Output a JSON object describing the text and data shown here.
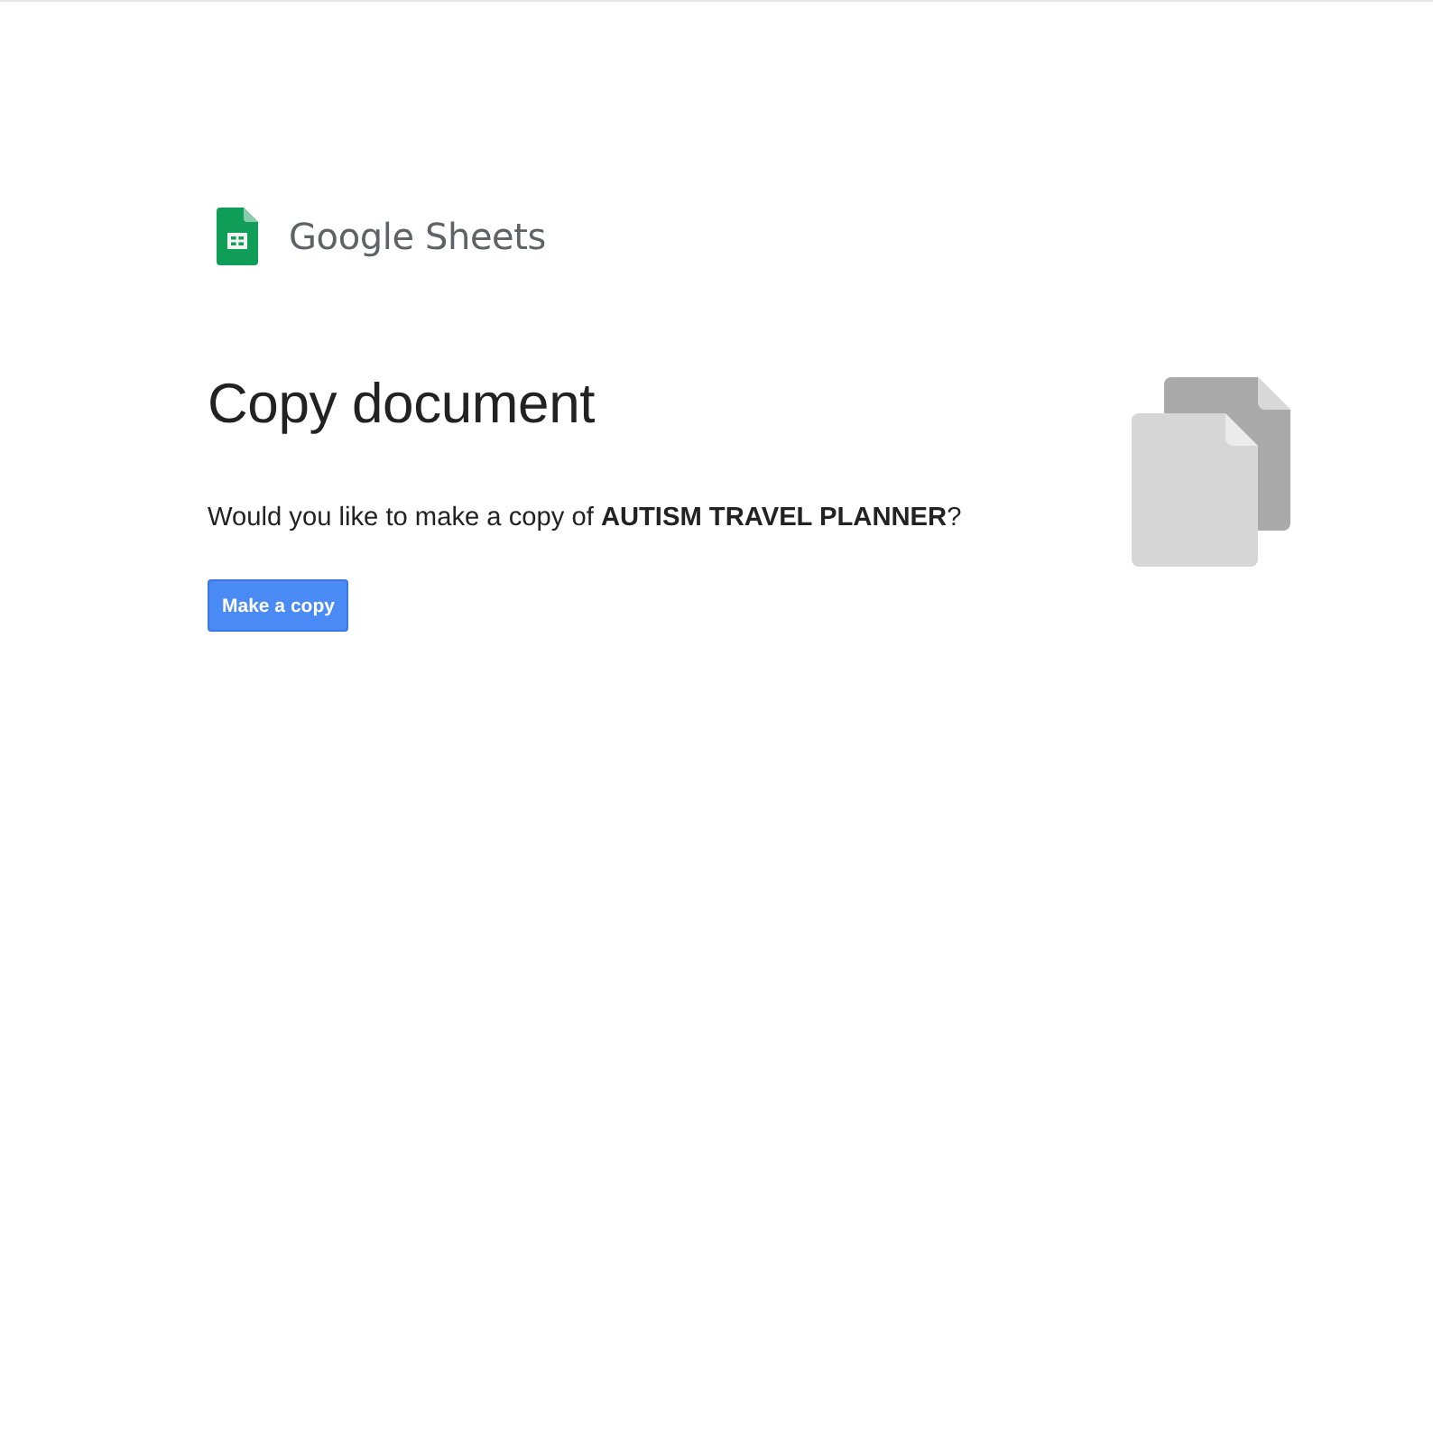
{
  "logo": {
    "text": "Google Sheets"
  },
  "heading": "Copy document",
  "prompt": "Would you like to make a copy of **AUTISM TRAVEL PLANNER**?",
  "button": {
    "label": "Make a copy"
  }
}
